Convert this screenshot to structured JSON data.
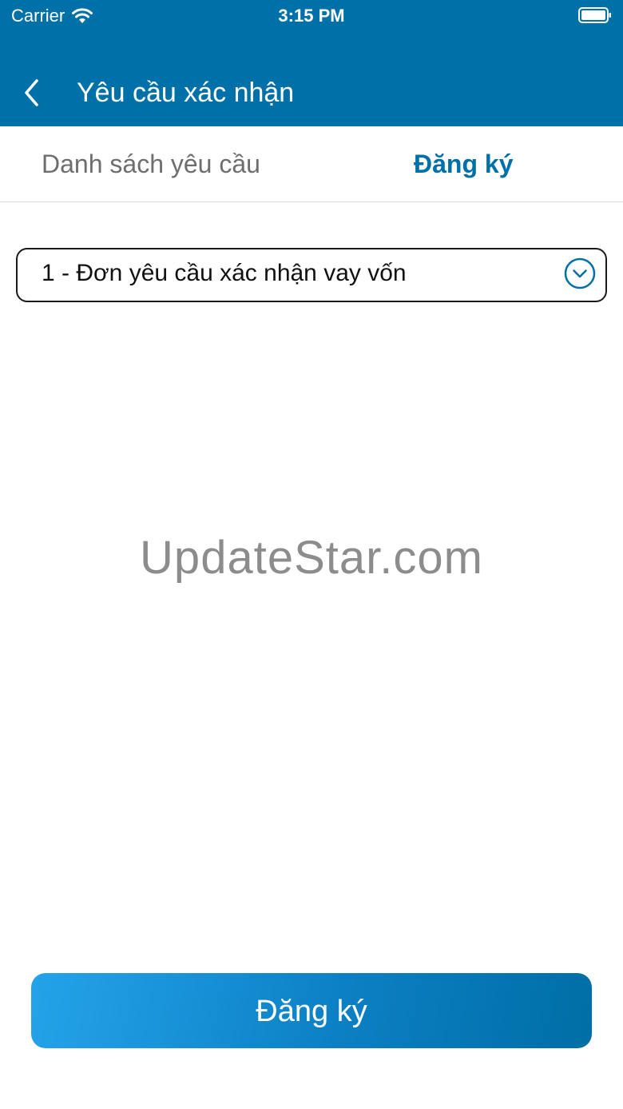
{
  "status_bar": {
    "carrier": "Carrier",
    "time": "3:15 PM",
    "wifi_icon": "wifi-icon",
    "battery_icon": "battery-icon"
  },
  "nav": {
    "title": "Yêu cầu xác nhận",
    "back_icon": "chevron-left-icon"
  },
  "tabs": [
    {
      "label": "Danh sách yêu cầu",
      "active": false
    },
    {
      "label": "Đăng ký",
      "active": true
    }
  ],
  "form": {
    "request_type_value": "1 - Đơn yêu cầu xác nhận vay vốn",
    "dropdown_icon": "chevron-down-circle-icon"
  },
  "watermark": "UpdateStar.com",
  "actions": {
    "submit_label": "Đăng ký"
  },
  "colors": {
    "brand": "#0070a8",
    "button_gradient_start": "#24a3ea",
    "button_gradient_end": "#006ea6"
  }
}
